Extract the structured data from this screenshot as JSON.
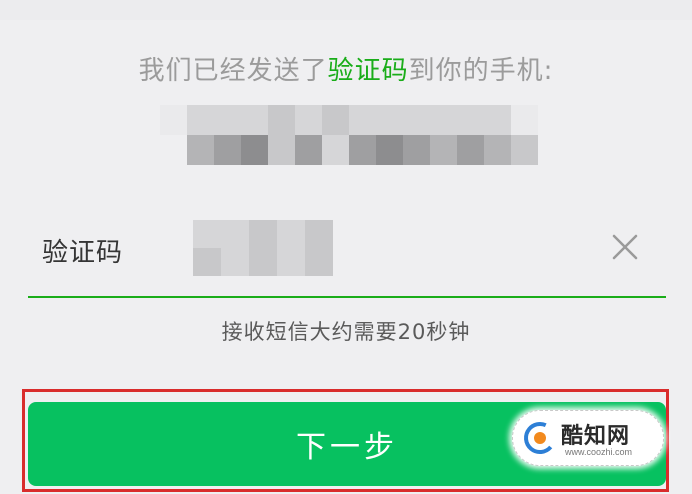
{
  "verify": {
    "sent_prefix": "我们已经发送了",
    "sent_highlight": "验证码",
    "sent_suffix": "到你的手机:",
    "code_label": "验证码",
    "code_value": "",
    "clear_icon": "close-icon",
    "hint": "接收短信大约需要20秒钟",
    "next_label": "下一步"
  },
  "watermark": {
    "name": "酷知网",
    "url": "www.coozhi.com",
    "logo_icon": "coozhi-logo-icon"
  },
  "colors": {
    "accent": "#1aad19",
    "button": "#07c160",
    "frame": "#d92c2c",
    "background": "#efeff1"
  }
}
